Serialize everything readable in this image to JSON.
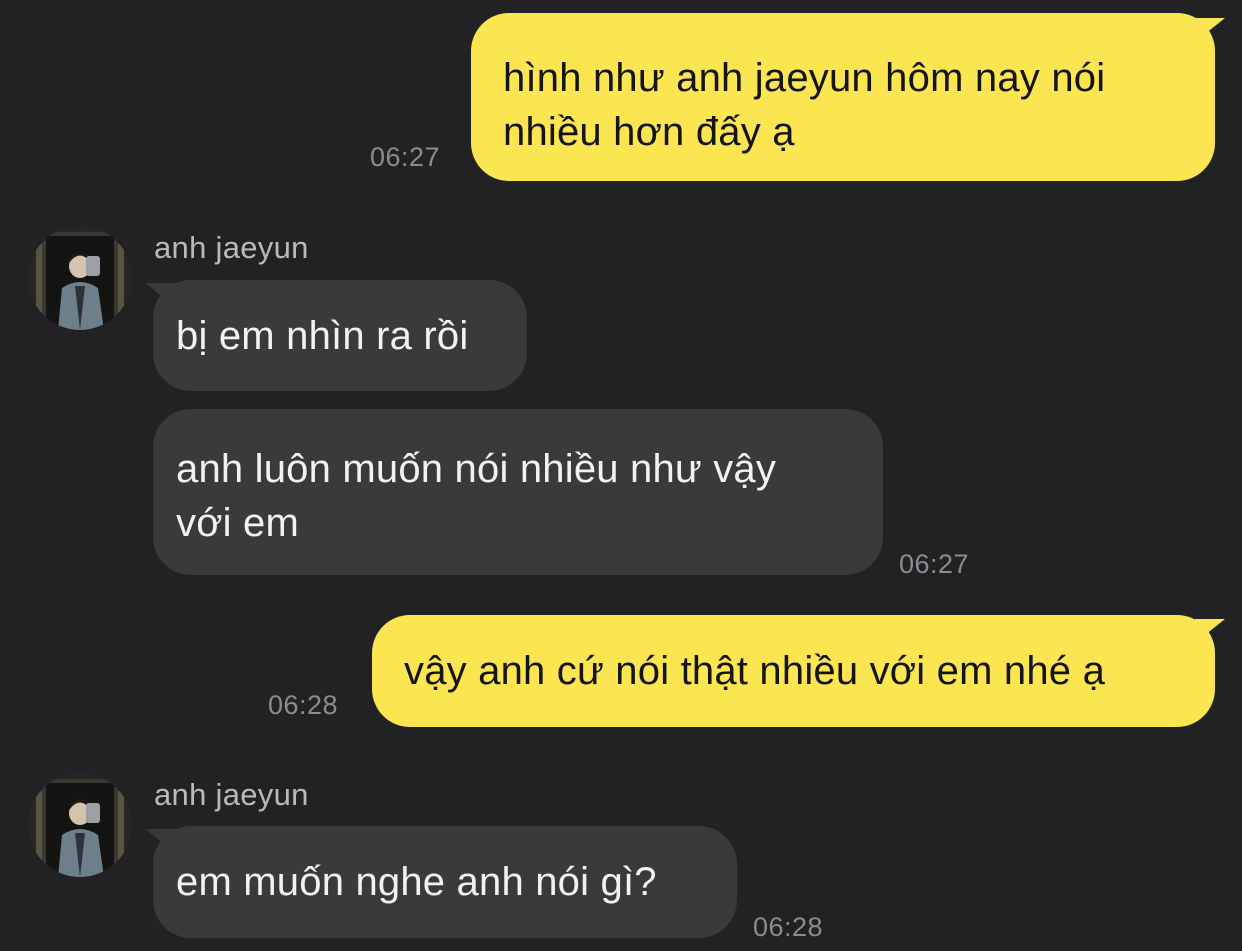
{
  "chat": {
    "messages": [
      {
        "direction": "outgoing",
        "text_lines": [
          "hình như anh jaeyun hôm nay nói",
          "nhiều hơn đấy ạ"
        ],
        "time": "06:27"
      },
      {
        "direction": "incoming",
        "sender": "anh jaeyun",
        "text_lines": [
          "bị em nhìn ra rồi"
        ]
      },
      {
        "direction": "incoming",
        "text_lines": [
          "anh luôn muốn nói nhiều như vậy",
          "với em"
        ],
        "time": "06:27"
      },
      {
        "direction": "outgoing",
        "text_lines": [
          "vậy anh cứ nói thật nhiều với em nhé ạ"
        ],
        "time": "06:28"
      },
      {
        "direction": "incoming",
        "sender": "anh jaeyun",
        "text_lines": [
          "em muốn nghe anh nói gì?"
        ],
        "time": "06:28"
      }
    ]
  },
  "theme": {
    "background": "#222225",
    "outgoing_bubble": "#fbe550",
    "incoming_bubble": "#3a3a3d",
    "timestamp_color": "#8c8c90"
  },
  "icons": {
    "avatar": "profile-photo"
  }
}
